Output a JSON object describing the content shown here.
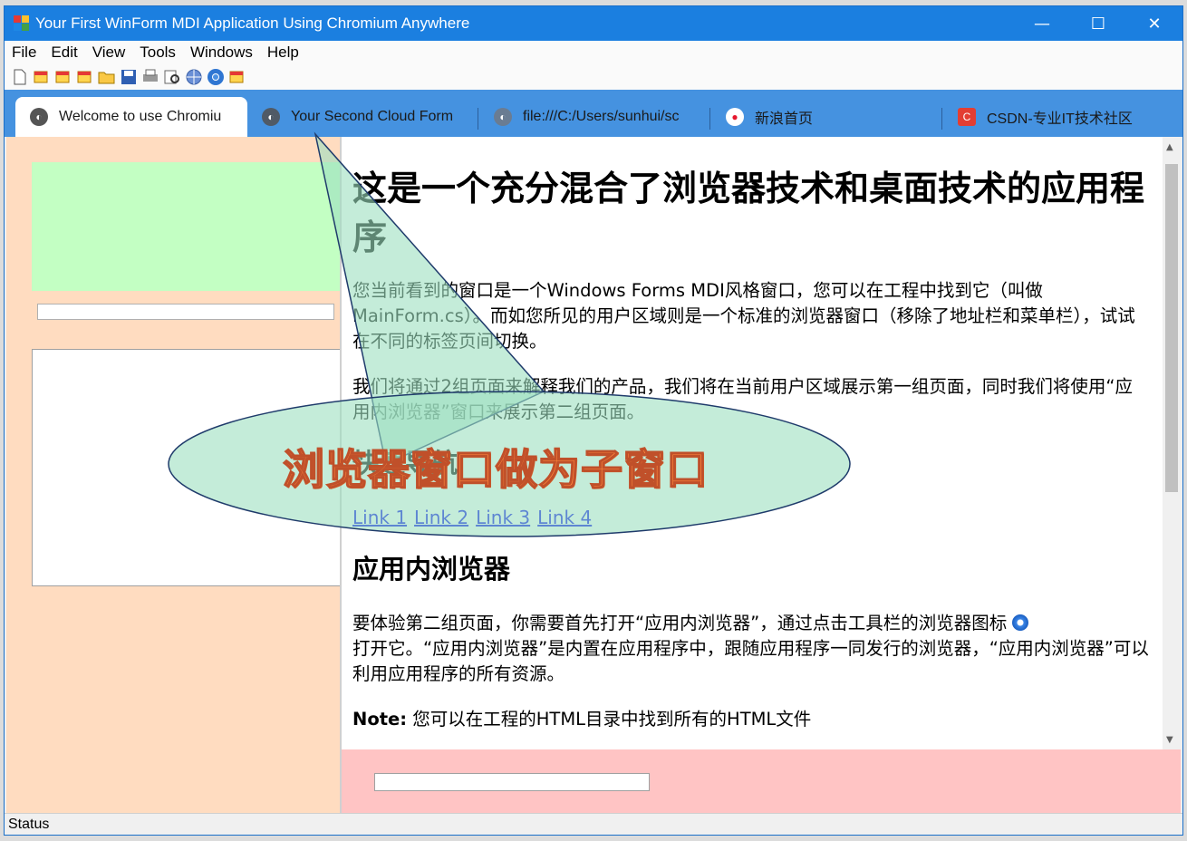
{
  "window": {
    "title": "Your First WinForm MDI Application Using Chromium Anywhere",
    "controls": [
      "—",
      "☐",
      "✕"
    ]
  },
  "menu": [
    "File",
    "Edit",
    "View",
    "Tools",
    "Windows",
    "Help"
  ],
  "toolbar_icons": [
    "new-icon",
    "window-icon",
    "window-icon",
    "window-icon",
    "open-folder-icon",
    "save-icon",
    "print-icon",
    "print-preview-icon",
    "web-icon",
    "chrome-icon",
    "window-icon"
  ],
  "tabs": [
    {
      "label": "Welcome to use Chromiu",
      "icon": "globe-icon",
      "active": true
    },
    {
      "label": "Your Second Cloud Form",
      "icon": "globe-icon",
      "active": false
    },
    {
      "label": "file:///C:/Users/sunhui/sc",
      "icon": "globe-icon",
      "active": false
    },
    {
      "label": "新浪首页",
      "icon": "weibo-icon",
      "active": false
    },
    {
      "label": "CSDN-专业IT技术社区",
      "icon": "csdn-icon",
      "active": false
    }
  ],
  "content": {
    "heading": "这是一个充分混合了浏览器技术和桌面技术的应用程序",
    "para1": "您当前看到的窗口是一个Windows Forms MDI风格窗口，您可以在工程中找到它（叫做MainForm.cs）。而如您所见的用户区域则是一个标准的浏览器窗口（移除了地址栏和菜单栏），试试在不同的标签页间切换。",
    "para2": "我们将通过2组页面来解释我们的产品，我们将在当前用户区域展示第一组页面，同时我们将使用“应用内浏览器”窗口来展示第二组页面。",
    "nav_heading": "快速导航",
    "links": [
      "Link 1",
      "Link 2",
      "Link 3",
      "Link 4"
    ],
    "browser_heading": "应用内浏览器",
    "para3_a": "要体验第二组页面，你需要首先打开“应用内浏览器”，通过点击工具栏的浏览器图标",
    "para3_b": "打开它。“应用内浏览器”是内置在应用程序中，跟随应用程序一同发行的浏览器，“应用内浏览器”可以利用应用程序的所有资源。",
    "note_label": "Note:",
    "note_text": "您可以在工程的HTML目录中找到所有的HTML文件"
  },
  "callout": {
    "text": "浏览器窗口做为子窗口"
  },
  "status": {
    "text": "Status"
  },
  "colors": {
    "titlebar": "#1b7fe0",
    "tabstrip": "#4592e0",
    "left_pane": "#ffdcc0",
    "green_box": "#c3ffc3",
    "bottom_pane": "#ffc4c4",
    "callout_fill": "#9de0c0",
    "callout_text": "#ff8a3d"
  }
}
